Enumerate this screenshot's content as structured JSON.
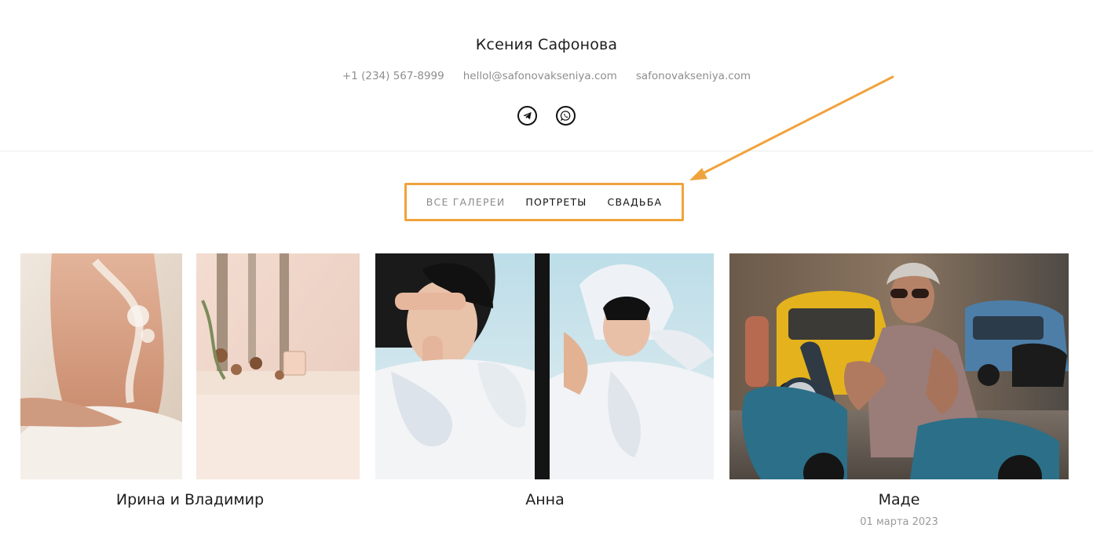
{
  "site": {
    "title": "Ксения Сафонова",
    "phone": "+1 (234) 567-8999",
    "email": "hellol@safonovakseniya.com",
    "website": "safonovakseniya.com"
  },
  "socials": [
    {
      "icon": "telegram-icon"
    },
    {
      "icon": "whatsapp-icon"
    }
  ],
  "filters": {
    "all": "ВСЕ ГАЛЕРЕИ",
    "portraits": "ПОРТРЕТЫ",
    "wedding": "СВАДЬБА"
  },
  "galleries": [
    {
      "title": "Ирина и Владимир",
      "date": ""
    },
    {
      "title": "Анна",
      "date": ""
    },
    {
      "title": "Маде",
      "date": "01 марта 2023"
    }
  ],
  "colors": {
    "accent": "#f0a33c"
  }
}
